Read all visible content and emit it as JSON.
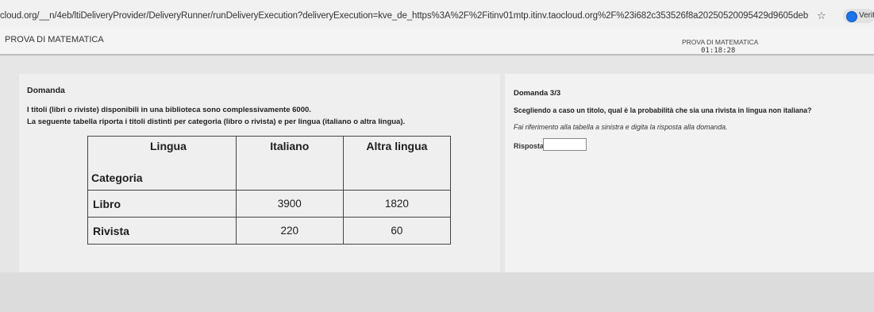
{
  "browser": {
    "url": "cloud.org/__n/4eb/ltiDeliveryProvider/DeliveryRunner/runDeliveryExecution?deliveryExecution=kve_de_https%3A%2F%2Fitinv01mtp.itinv.taocloud.org%2F%23i682c353526f8a20250520095429d9605deb",
    "extension_label": "Verifi"
  },
  "header": {
    "app_title": "PROVA DI MATEMATICA",
    "test_name": "PROVA DI MATEMATICA",
    "timer": "01:18:28"
  },
  "left": {
    "label": "Domanda",
    "stem_line1": "I titoli (libri o riviste) disponibili in una biblioteca sono complessivamente 6000.",
    "stem_line2": "La seguente tabella riporta i titoli distinti per categoria (libro o rivista) e per lingua (italiano o altra lingua).",
    "table": {
      "corner_top": "Lingua",
      "corner_bottom": "Categoria",
      "columns": [
        "Italiano",
        "Altra lingua"
      ],
      "rows": [
        {
          "label": "Libro",
          "values": [
            "3900",
            "1820"
          ]
        },
        {
          "label": "Rivista",
          "values": [
            "220",
            "60"
          ]
        }
      ]
    }
  },
  "right": {
    "counter": "Domanda 3/3",
    "question": "Scegliendo a caso un titolo, qual è la probabilità che sia una rivista in lingua non italiana?",
    "hint": "Fai riferimento alla tabella a sinistra e digita la risposta alla domanda.",
    "answer_label": "Risposta:",
    "answer_value": ""
  }
}
